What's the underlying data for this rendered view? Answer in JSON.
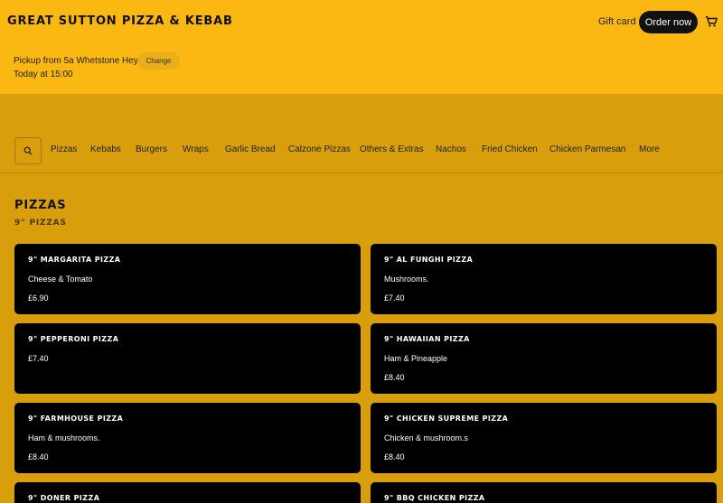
{
  "header": {
    "brand": "GREAT SUTTON PIZZA & KEBAB",
    "gift_card": "Gift card",
    "order_now": "Order now",
    "pickup_text": "Pickup from 5a Whetstone Hey",
    "change_label": "Change",
    "pickup_time": "Today at 15:00",
    "cart_icon": "cart-icon"
  },
  "categories": [
    "Pizzas",
    "Kebabs",
    "Burgers",
    "Wraps",
    "Garlic Bread",
    "Calzone Pizzas",
    "Others & Extras",
    "Nachos",
    "Fried Chicken",
    "Chicken Parmesan",
    "More"
  ],
  "section": {
    "title": "PIZZAS",
    "subtitle": "9\" PIZZAS"
  },
  "items": [
    {
      "name": "9\" MARGARITA PIZZA",
      "desc": "Cheese & Tomato",
      "price": "£6.90"
    },
    {
      "name": "9\" AL FUNGHI PIZZA",
      "desc": "Mushrooms.",
      "price": "£7.40"
    },
    {
      "name": "9\" PEPPERONI PIZZA",
      "desc": "",
      "price": "£7.40"
    },
    {
      "name": "9\" HAWAIIAN PIZZA",
      "desc": "Ham & Pineapple",
      "price": "£8.40"
    },
    {
      "name": "9\" FARMHOUSE PIZZA",
      "desc": "Ham & mushrooms.",
      "price": "£8.40"
    },
    {
      "name": "9\" CHICKEN SUPREME PIZZA",
      "desc": "Chicken & mushroom.s",
      "price": "£8.40"
    },
    {
      "name": "9\" DONER PIZZA",
      "desc": "",
      "price": ""
    },
    {
      "name": "9\" BBQ CHICKEN PIZZA",
      "desc": "",
      "price": ""
    }
  ],
  "colors": {
    "header_bg": "#fbb813",
    "page_bg": "#d89e0b",
    "card_bg": "#000000",
    "button_bg": "#111111"
  }
}
